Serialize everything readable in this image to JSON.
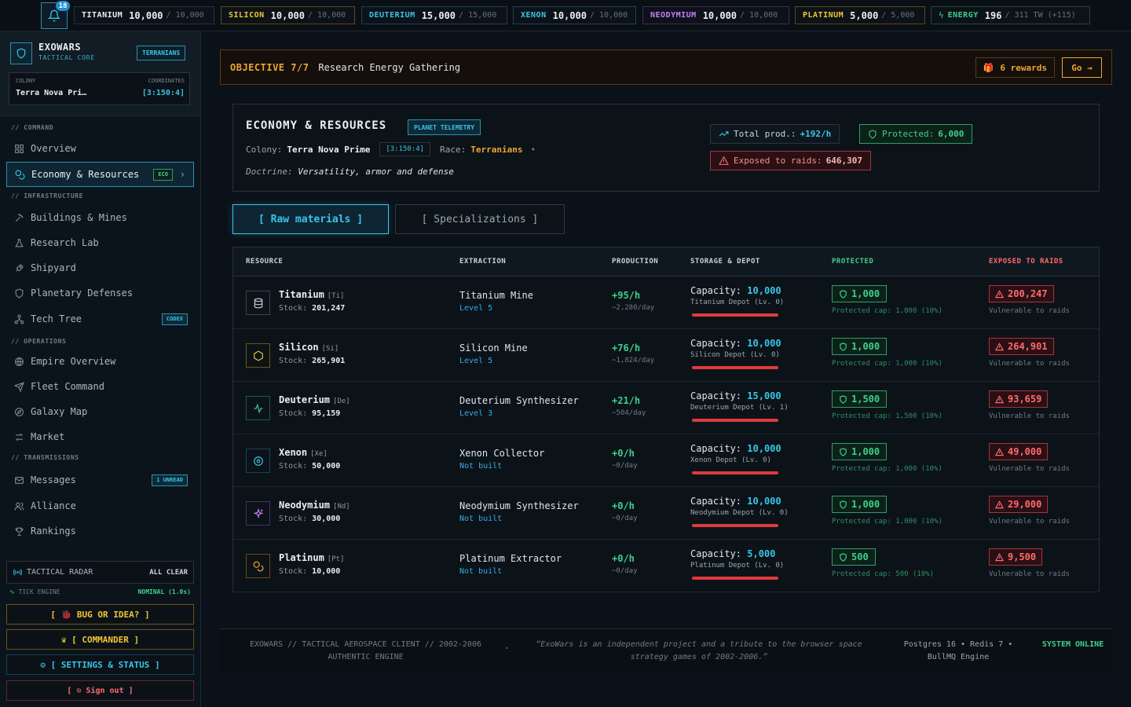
{
  "topbar": {
    "notifications": "18",
    "resources": [
      {
        "name": "TITANIUM",
        "value": "10,000",
        "max": "/ 10,000",
        "color": "#e8eef2",
        "border": "#27323d"
      },
      {
        "name": "SILICON",
        "value": "10,000",
        "max": "/ 10,000",
        "color": "#f0c531",
        "border": "#5a4a17"
      },
      {
        "name": "DEUTERIUM",
        "value": "15,000",
        "max": "/ 15,000",
        "color": "#39c5e8",
        "border": "#17425a"
      },
      {
        "name": "XENON",
        "value": "10,000",
        "max": "/ 10,000",
        "color": "#39c5e8",
        "border": "#17425a"
      },
      {
        "name": "NEODYMIUM",
        "value": "10,000",
        "max": "/ 10,000",
        "color": "#c77dff",
        "border": "#3f2a5a"
      },
      {
        "name": "PLATINUM",
        "value": "5,000",
        "max": "/ 5,000",
        "color": "#f0c531",
        "border": "#5a4a17"
      },
      {
        "name": "ENERGY",
        "value": "196",
        "max": "/ 311 TW (+115)",
        "color": "#3fcf8e",
        "border": "#1c4a35"
      }
    ]
  },
  "sidebar": {
    "brand": {
      "name": "EXOWARS",
      "sub": "TACTICAL CORE",
      "tag": "TERRANIANS"
    },
    "colony_label": "COLONY",
    "colony_name": "Terra Nova Pri…",
    "coord_label": "COORDINATES",
    "coords": "[3:150:4]",
    "sections": {
      "command": "// COMMAND",
      "infrastructure": "// INFRASTRUCTURE",
      "operations": "// OPERATIONS",
      "transmissions": "// TRANSMISSIONS"
    },
    "items": {
      "overview": "Overview",
      "economy": "Economy & Resources",
      "economy_badge": "ECO",
      "buildings": "Buildings & Mines",
      "research": "Research Lab",
      "shipyard": "Shipyard",
      "defenses": "Planetary Defenses",
      "techtree": "Tech Tree",
      "techtree_badge": "CODEX",
      "empire": "Empire Overview",
      "fleet": "Fleet Command",
      "galaxy": "Galaxy Map",
      "market": "Market",
      "messages": "Messages",
      "messages_badge": "1 UNREAD",
      "alliance": "Alliance",
      "rankings": "Rankings"
    },
    "radar": {
      "label": "TACTICAL RADAR",
      "status": "ALL CLEAR"
    },
    "tick": {
      "label": "TICK ENGINE",
      "status": "NOMINAL (1.0s)"
    },
    "buttons": {
      "bug": "[ 🐞 BUG OR IDEA? ]",
      "commander": "♛ [ COMMANDER ]",
      "settings": "⚙ [ SETTINGS & STATUS ]",
      "signout": "[ ⎋ Sign out ]"
    }
  },
  "objective": {
    "label": "OBJECTIVE 7/7",
    "text": "Research Energy Gathering",
    "rewards": "6 rewards",
    "go": "Go →"
  },
  "panel": {
    "title": "ECONOMY & RESOURCES",
    "tag": "PLANET TELEMETRY",
    "colony_label": "Colony:",
    "colony": "Terra Nova Prime",
    "coords": "[3:150:4]",
    "race_label": "Race:",
    "race": "Terranians",
    "doctrine_label": "Doctrine:",
    "doctrine": "Versatility, armor and defense",
    "total_prod_label": "Total prod.:",
    "total_prod": "+192/h",
    "protected_label": "Protected:",
    "protected": "6,000",
    "exposed_label": "Exposed to raids:",
    "exposed": "646,307"
  },
  "tabs": {
    "raw": "[ Raw materials ]",
    "spec": "[ Specializations ]"
  },
  "table": {
    "headers": {
      "resource": "RESOURCE",
      "extraction": "EXTRACTION",
      "production": "PRODUCTION",
      "storage": "STORAGE & DEPOT",
      "protected": "PROTECTED",
      "exposed": "EXPOSED TO RAIDS"
    },
    "capacity_label": "Capacity:",
    "stock_label": "Stock:",
    "vuln_label": "Vulnerable to raids",
    "rows": [
      {
        "name": "Titanium",
        "sym": "[Ti]",
        "stock": "201,247",
        "ext": "Titanium Mine",
        "lvl": "Level 5",
        "prod": "+95/h",
        "day": "~2,280/day",
        "cap": "10,000",
        "depot": "Titanium Depot (Lv. 0)",
        "prot": "1,000",
        "pcap": "Protected cap: 1,000 (10%)",
        "exp": "200,247",
        "icon": "database-icon",
        "color": "#c8d3dc",
        "border": "#3a4550"
      },
      {
        "name": "Silicon",
        "sym": "[Si]",
        "stock": "265,901",
        "ext": "Silicon Mine",
        "lvl": "Level 5",
        "prod": "+76/h",
        "day": "~1,824/day",
        "cap": "10,000",
        "depot": "Silicon Depot (Lv. 0)",
        "prot": "1,000",
        "pcap": "Protected cap: 1,000 (10%)",
        "exp": "264,901",
        "icon": "hexagon-icon",
        "color": "#f0c531",
        "border": "#6a5517"
      },
      {
        "name": "Deuterium",
        "sym": "[De]",
        "stock": "95,159",
        "ext": "Deuterium Synthesizer",
        "lvl": "Level 3",
        "prod": "+21/h",
        "day": "~504/day",
        "cap": "15,000",
        "depot": "Deuterium Depot (Lv. 1)",
        "prot": "1,500",
        "pcap": "Protected cap: 1,500 (10%)",
        "exp": "93,659",
        "icon": "pulse-icon",
        "color": "#3fcf8e",
        "border": "#1f5a40"
      },
      {
        "name": "Xenon",
        "sym": "[Xe]",
        "stock": "50,000",
        "ext": "Xenon Collector",
        "lvl": "Not built",
        "prod": "+0/h",
        "day": "~0/day",
        "cap": "10,000",
        "depot": "Xenon Depot (Lv. 0)",
        "prot": "1,000",
        "pcap": "Protected cap: 1,000 (10%)",
        "exp": "49,000",
        "icon": "target-icon",
        "color": "#39c5e8",
        "border": "#17425a"
      },
      {
        "name": "Neodymium",
        "sym": "[Nd]",
        "stock": "30,000",
        "ext": "Neodymium Synthesizer",
        "lvl": "Not built",
        "prod": "+0/h",
        "day": "~0/day",
        "cap": "10,000",
        "depot": "Neodymium Depot (Lv. 0)",
        "prot": "1,000",
        "pcap": "Protected cap: 1,000 (10%)",
        "exp": "29,000",
        "icon": "sparkle-icon",
        "color": "#c77dff",
        "border": "#4a2f6a"
      },
      {
        "name": "Platinum",
        "sym": "[Pt]",
        "stock": "10,000",
        "ext": "Platinum Extractor",
        "lvl": "Not built",
        "prod": "+0/h",
        "day": "~0/day",
        "cap": "5,000",
        "depot": "Platinum Depot (Lv. 0)",
        "prot": "500",
        "pcap": "Protected cap: 500 (10%)",
        "exp": "9,500",
        "icon": "coins-icon",
        "color": "#f0a531",
        "border": "#6a4a17"
      }
    ]
  },
  "footer": {
    "left": "EXOWARS // TACTICAL AEROSPACE CLIENT // 2002-2006 AUTHENTIC ENGINE",
    "quote": "“ExoWars is an independent project and a tribute to the browser space strategy games of 2002-2006.”",
    "stack": "Postgres 16 • Redis 7 • BullMQ Engine",
    "status": "SYSTEM ONLINE"
  }
}
